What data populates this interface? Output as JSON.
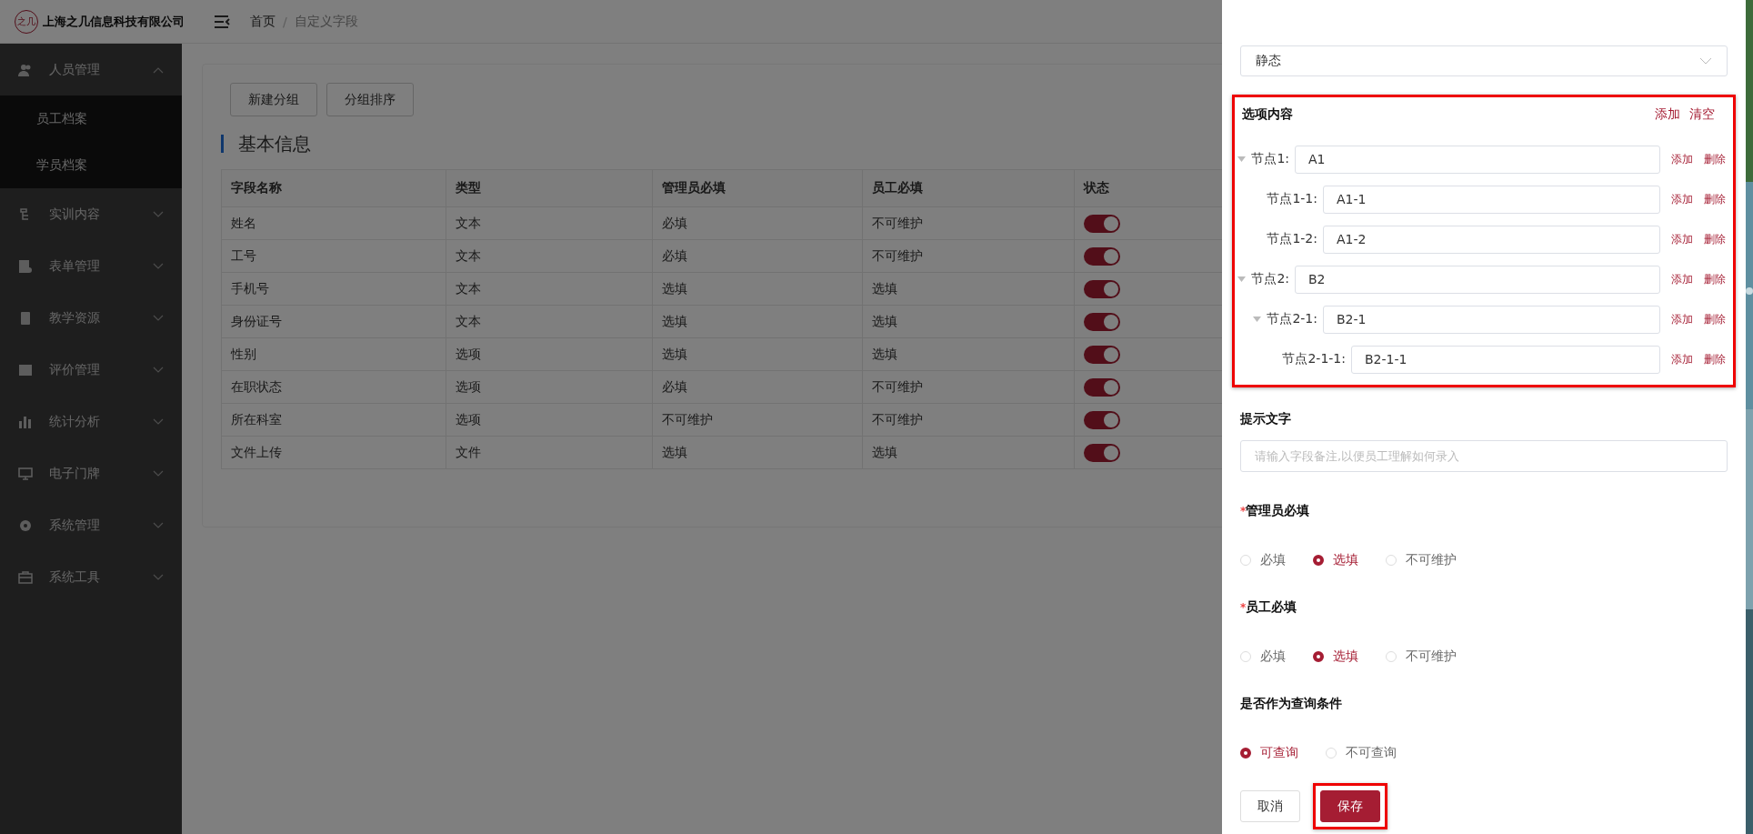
{
  "header": {
    "logo_text": "之几",
    "company": "上海之几信息科技有限公司",
    "breadcrumb_separator": "/",
    "breadcrumb": [
      {
        "label": "首页",
        "current": false
      },
      {
        "label": "自定义字段",
        "current": true
      }
    ]
  },
  "sidebar": {
    "items": [
      {
        "label": "人员管理",
        "expanded": true,
        "children": [
          {
            "label": "员工档案"
          },
          {
            "label": "学员档案"
          }
        ]
      },
      {
        "label": "实训内容",
        "expanded": false
      },
      {
        "label": "表单管理",
        "expanded": false
      },
      {
        "label": "教学资源",
        "expanded": false
      },
      {
        "label": "评价管理",
        "expanded": false
      },
      {
        "label": "统计分析",
        "expanded": false
      },
      {
        "label": "电子门牌",
        "expanded": false
      },
      {
        "label": "系统管理",
        "expanded": false
      },
      {
        "label": "系统工具",
        "expanded": false
      }
    ]
  },
  "page": {
    "buttons": [
      "新建分组",
      "分组排序"
    ],
    "section_title": "基本信息",
    "table": {
      "columns": [
        "字段名称",
        "类型",
        "管理员必填",
        "员工必填",
        "状态"
      ],
      "rows": [
        {
          "cells": [
            "姓名",
            "文本",
            "必填",
            "不可维护"
          ],
          "on": true
        },
        {
          "cells": [
            "工号",
            "文本",
            "必填",
            "不可维护"
          ],
          "on": true
        },
        {
          "cells": [
            "手机号",
            "文本",
            "选填",
            "选填"
          ],
          "on": true
        },
        {
          "cells": [
            "身份证号",
            "文本",
            "选填",
            "选填"
          ],
          "on": true
        },
        {
          "cells": [
            "性别",
            "选项",
            "选填",
            "选填"
          ],
          "on": true
        },
        {
          "cells": [
            "在职状态",
            "选项",
            "必填",
            "不可维护"
          ],
          "on": true
        },
        {
          "cells": [
            "所在科室",
            "选项",
            "不可维护",
            "不可维护"
          ],
          "on": true
        },
        {
          "cells": [
            "文件上传",
            "文件",
            "选填",
            "选填"
          ],
          "on": true
        }
      ]
    }
  },
  "drawer": {
    "select": {
      "value": "静态"
    },
    "options": {
      "title": "选项内容",
      "highlighted": true,
      "actions": [
        "添加",
        "清空"
      ],
      "nodes": [
        {
          "label": "节点1:",
          "value": "A1",
          "actions": [
            "添加",
            "删除"
          ],
          "expanded": true,
          "children": [
            {
              "label": "节点1-1:",
              "value": "A1-1",
              "actions": [
                "添加",
                "删除"
              ]
            },
            {
              "label": "节点1-2:",
              "value": "A1-2",
              "actions": [
                "添加",
                "删除"
              ]
            }
          ]
        },
        {
          "label": "节点2:",
          "value": "B2",
          "actions": [
            "添加",
            "删除"
          ],
          "expanded": true,
          "children": [
            {
              "label": "节点2-1:",
              "value": "B2-1",
              "actions": [
                "添加",
                "删除"
              ],
              "expanded": true,
              "children": [
                {
                  "label": "节点2-1-1:",
                  "value": "B2-1-1",
                  "actions": [
                    "添加",
                    "删除"
                  ]
                }
              ]
            }
          ]
        }
      ]
    },
    "hint": {
      "label": "提示文字",
      "placeholder": "请输入字段备注,以便员工理解如何录入"
    },
    "radio_groups": [
      {
        "label": "管理员必填",
        "required": true,
        "options": [
          {
            "label": "必填",
            "selected": false
          },
          {
            "label": "选填",
            "selected": true
          },
          {
            "label": "不可维护",
            "selected": false
          }
        ]
      },
      {
        "label": "员工必填",
        "required": true,
        "options": [
          {
            "label": "必填",
            "selected": false
          },
          {
            "label": "选填",
            "selected": true
          },
          {
            "label": "不可维护",
            "selected": false
          }
        ]
      },
      {
        "label": "是否作为查询条件",
        "required": false,
        "options": [
          {
            "label": "可查询",
            "selected": true
          },
          {
            "label": "不可查询",
            "selected": false
          }
        ]
      }
    ],
    "required_mark": "*",
    "buttons": [
      {
        "label": "取消",
        "kind": "default",
        "highlighted": false
      },
      {
        "label": "保存",
        "kind": "primary",
        "highlighted": true
      }
    ]
  }
}
